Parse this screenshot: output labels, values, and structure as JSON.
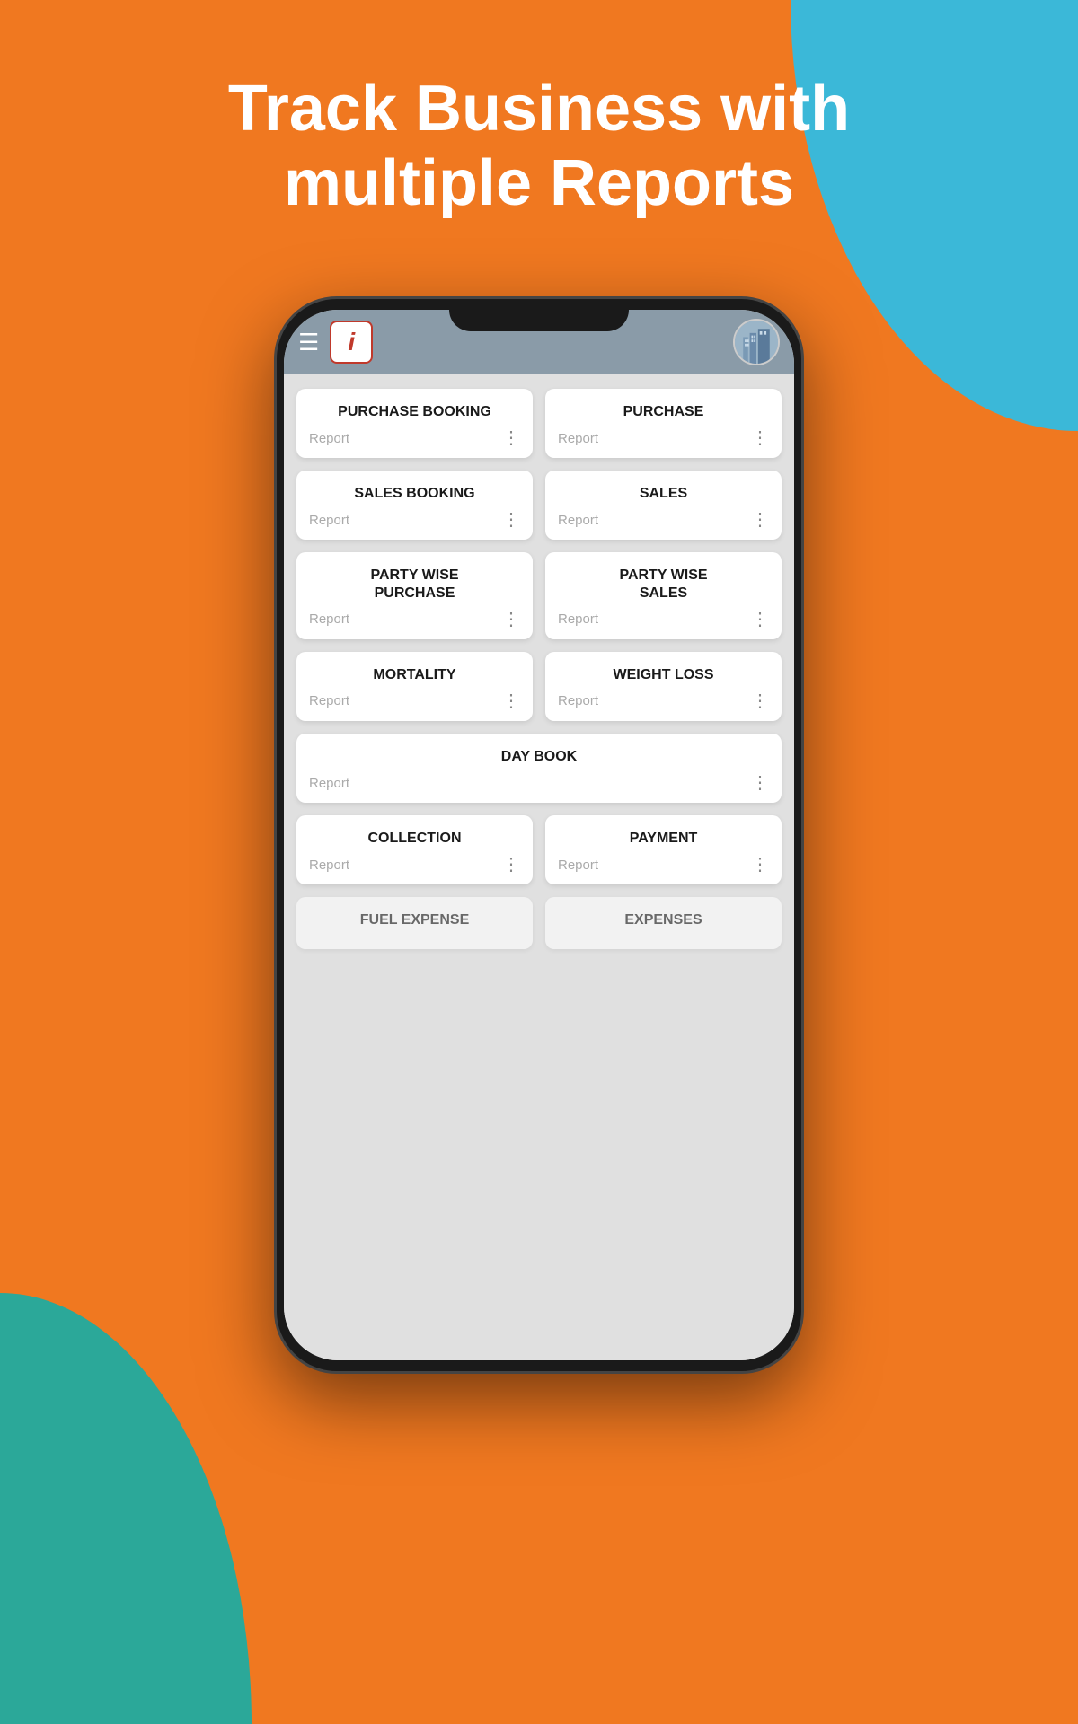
{
  "background": {
    "main_color": "#F07820",
    "blue_accent": "#3BB8D8",
    "teal_accent": "#2BA899"
  },
  "headline": {
    "line1": "Track Business with",
    "line2": "multiple Reports"
  },
  "app": {
    "logo_letter": "i",
    "header_bg": "#8a9ba8"
  },
  "cards": [
    {
      "id": "purchase-booking",
      "title": "PURCHASE BOOKING",
      "subtitle": "Report",
      "full_width": false
    },
    {
      "id": "purchase",
      "title": "PURCHASE",
      "subtitle": "Report",
      "full_width": false
    },
    {
      "id": "sales-booking",
      "title": "SALES BOOKING",
      "subtitle": "Report",
      "full_width": false
    },
    {
      "id": "sales",
      "title": "SALES",
      "subtitle": "Report",
      "full_width": false
    },
    {
      "id": "party-wise-purchase",
      "title": "PARTY WISE\nPURCHASE",
      "subtitle": "Report",
      "full_width": false
    },
    {
      "id": "party-wise-sales",
      "title": "PARTY WISE\nSALES",
      "subtitle": "Report",
      "full_width": false
    },
    {
      "id": "mortality",
      "title": "MORTALITY",
      "subtitle": "Report",
      "full_width": false
    },
    {
      "id": "weight-loss",
      "title": "WEIGHT LOSS",
      "subtitle": "Report",
      "full_width": false
    },
    {
      "id": "day-book",
      "title": "DAY BOOK",
      "subtitle": "Report",
      "full_width": true
    },
    {
      "id": "collection",
      "title": "COLLECTION",
      "subtitle": "Report",
      "full_width": false
    },
    {
      "id": "payment",
      "title": "PAYMENT",
      "subtitle": "Report",
      "full_width": false
    }
  ],
  "labels": {
    "report": "Report",
    "more_options": "⋮"
  }
}
